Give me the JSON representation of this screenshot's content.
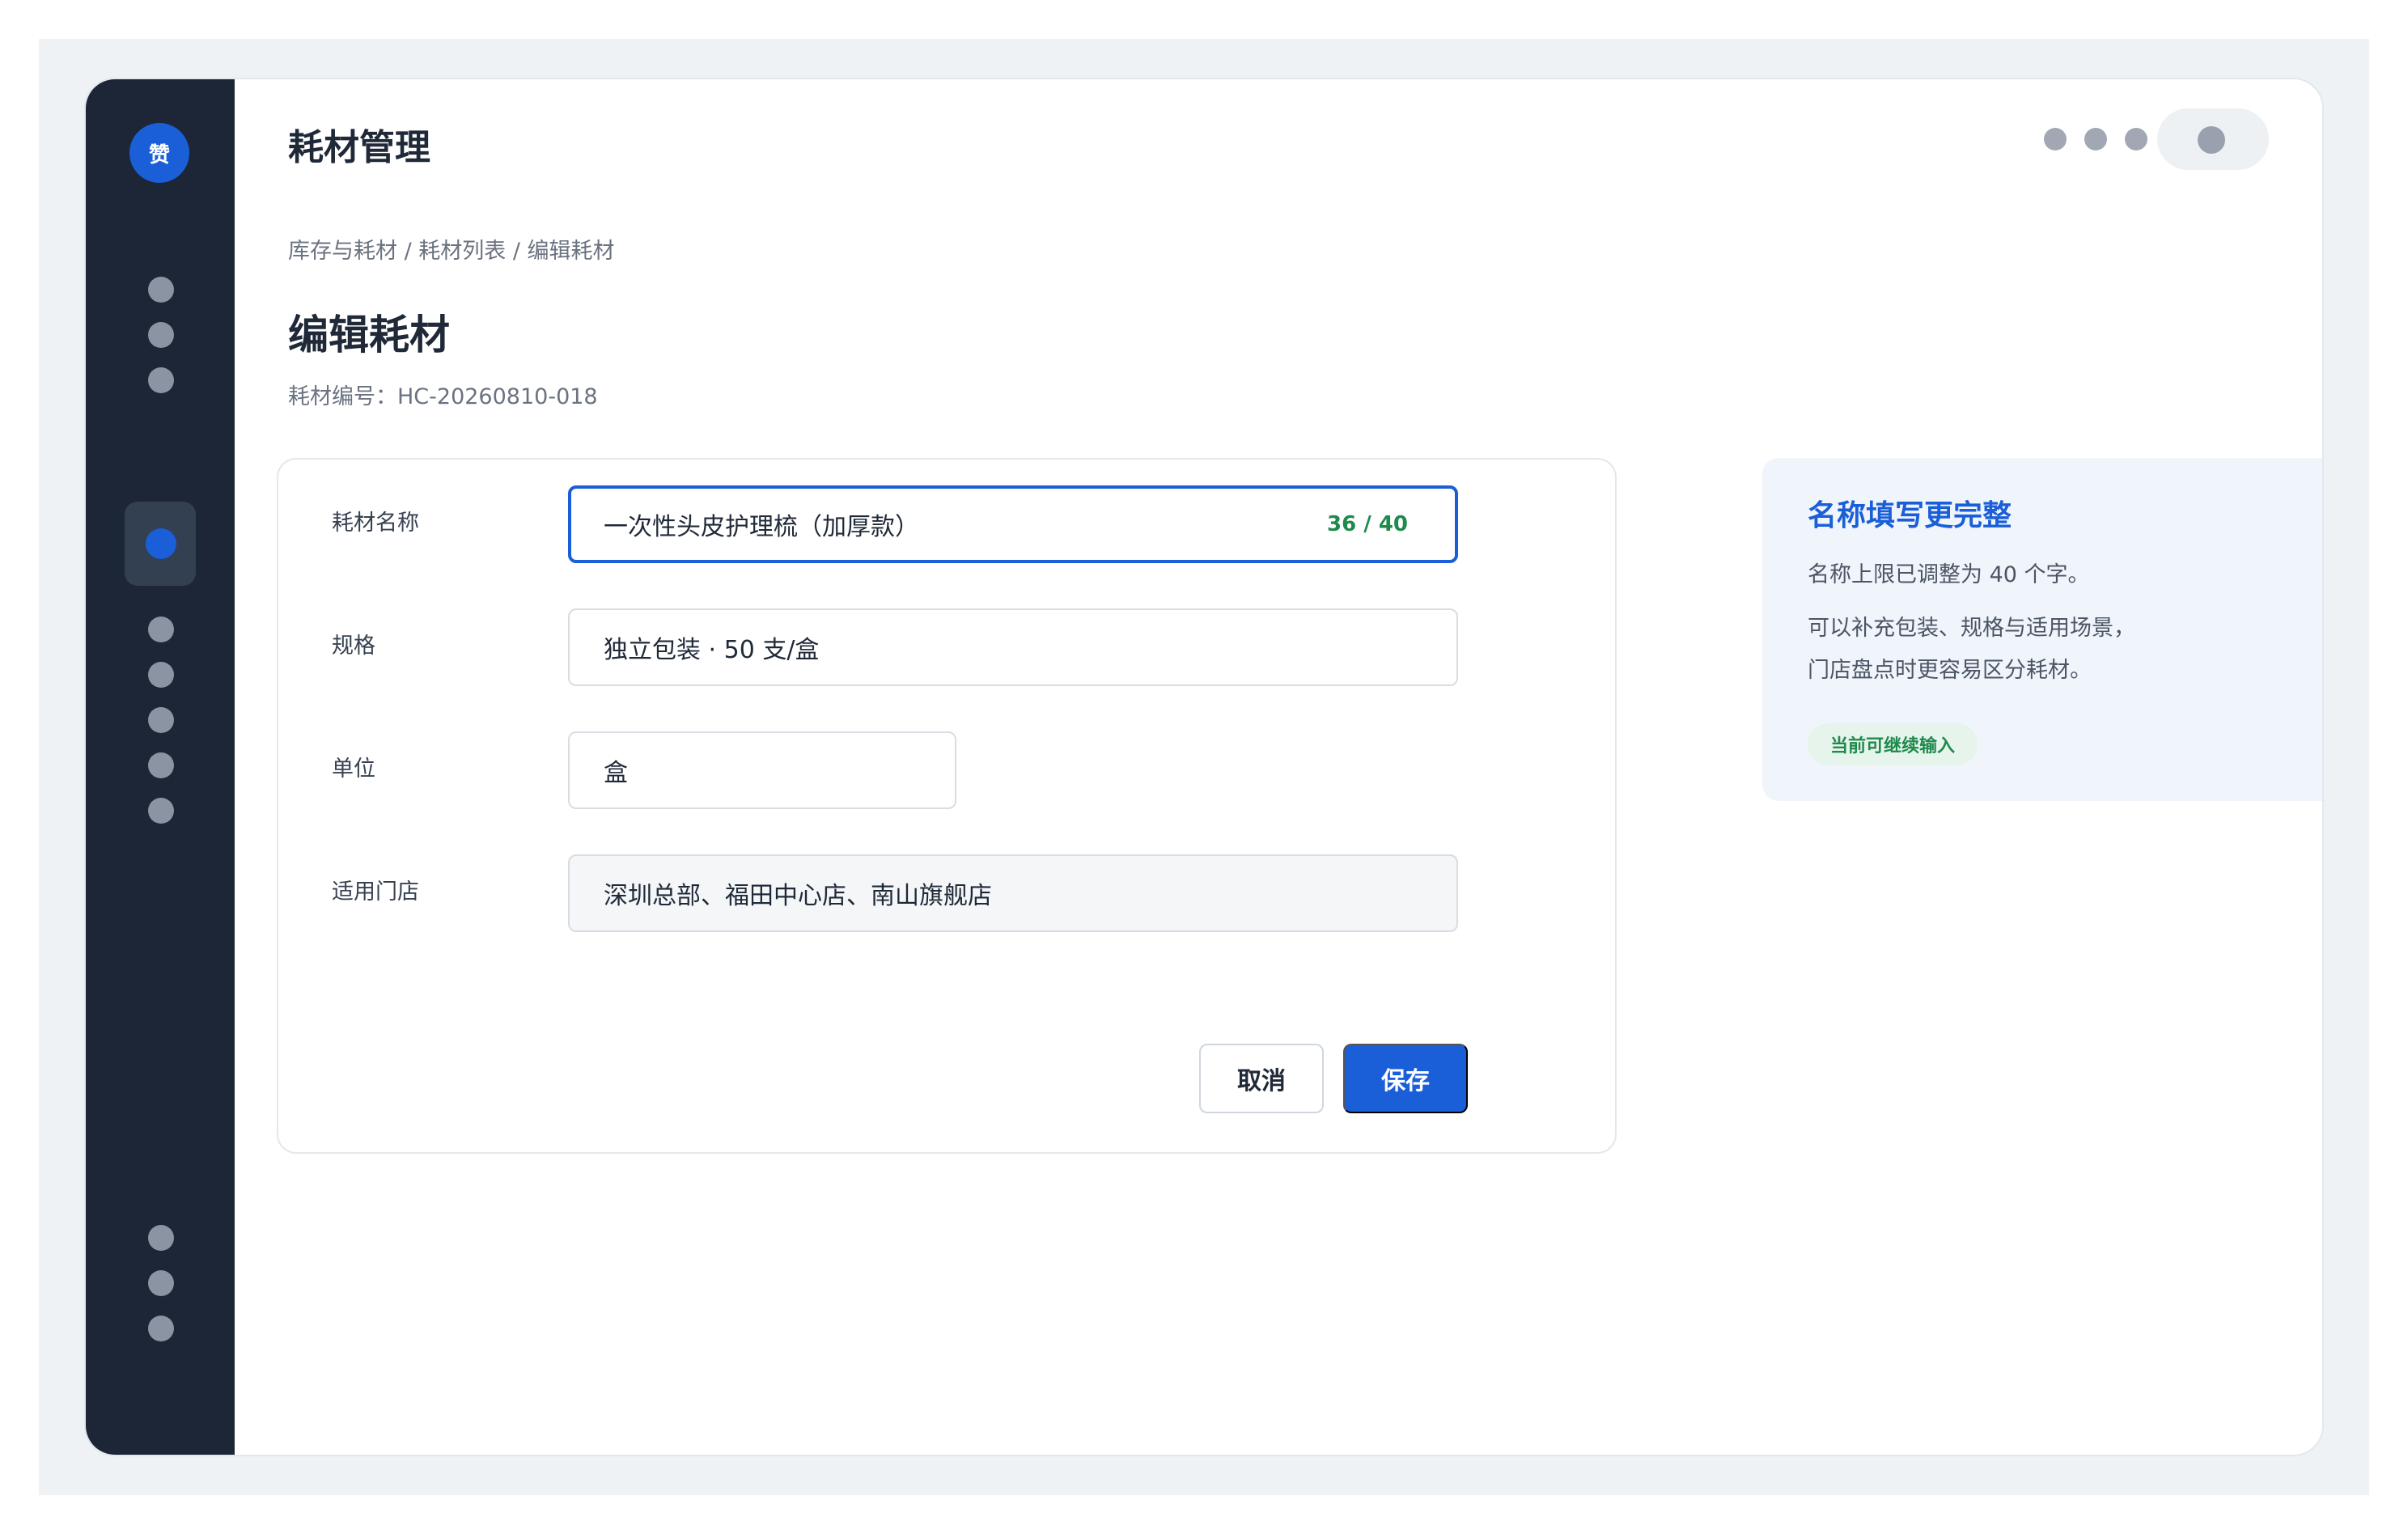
{
  "app": {
    "logo_text": "赞",
    "title": "耗材管理"
  },
  "header": {
    "menu_dots_icon": "more-dots-icon",
    "avatar_icon": "avatar-icon"
  },
  "sidebar": {
    "items": [
      {
        "icon": "nav-icon-1",
        "active": false
      },
      {
        "icon": "nav-icon-2",
        "active": false
      },
      {
        "icon": "nav-icon-3",
        "active": false
      },
      {
        "icon": "nav-icon-4",
        "active": true
      },
      {
        "icon": "nav-icon-5",
        "active": false
      },
      {
        "icon": "nav-icon-6",
        "active": false
      },
      {
        "icon": "nav-icon-7",
        "active": false
      },
      {
        "icon": "nav-icon-8",
        "active": false
      },
      {
        "icon": "nav-icon-9",
        "active": false
      }
    ],
    "bottom_items": [
      {
        "icon": "nav-icon-10"
      },
      {
        "icon": "nav-icon-11"
      },
      {
        "icon": "nav-icon-12"
      }
    ],
    "active_color": "#1a5fd8"
  },
  "breadcrumb": "库存与耗材 / 耗材列表 / 编辑耗材",
  "page": {
    "title": "编辑耗材",
    "code_line": "耗材编号：HC-20260810-018"
  },
  "form": {
    "name_label": "耗材名称",
    "name_value": "一次性头皮护理梳（加厚款）",
    "name_counter": "36 / 40",
    "spec_label": "规格",
    "spec_value": "独立包装 · 50 支/盒",
    "unit_label": "单位",
    "unit_value": "盒",
    "store_label": "适用门店",
    "store_value": "深圳总部、福田中心店、南山旗舰店",
    "cancel_label": "取消",
    "save_label": "保存"
  },
  "tip": {
    "title": "名称填写更完整",
    "line1": "名称上限已调整为 40 个字。",
    "line2": "可以补充包装、规格与适用场景，",
    "line3": "门店盘点时更容易区分耗材。",
    "badge": "当前可继续输入"
  },
  "colors": {
    "accent": "#1a5fd8",
    "success": "#1e8a4c",
    "sidebar_bg": "#1c2636"
  }
}
